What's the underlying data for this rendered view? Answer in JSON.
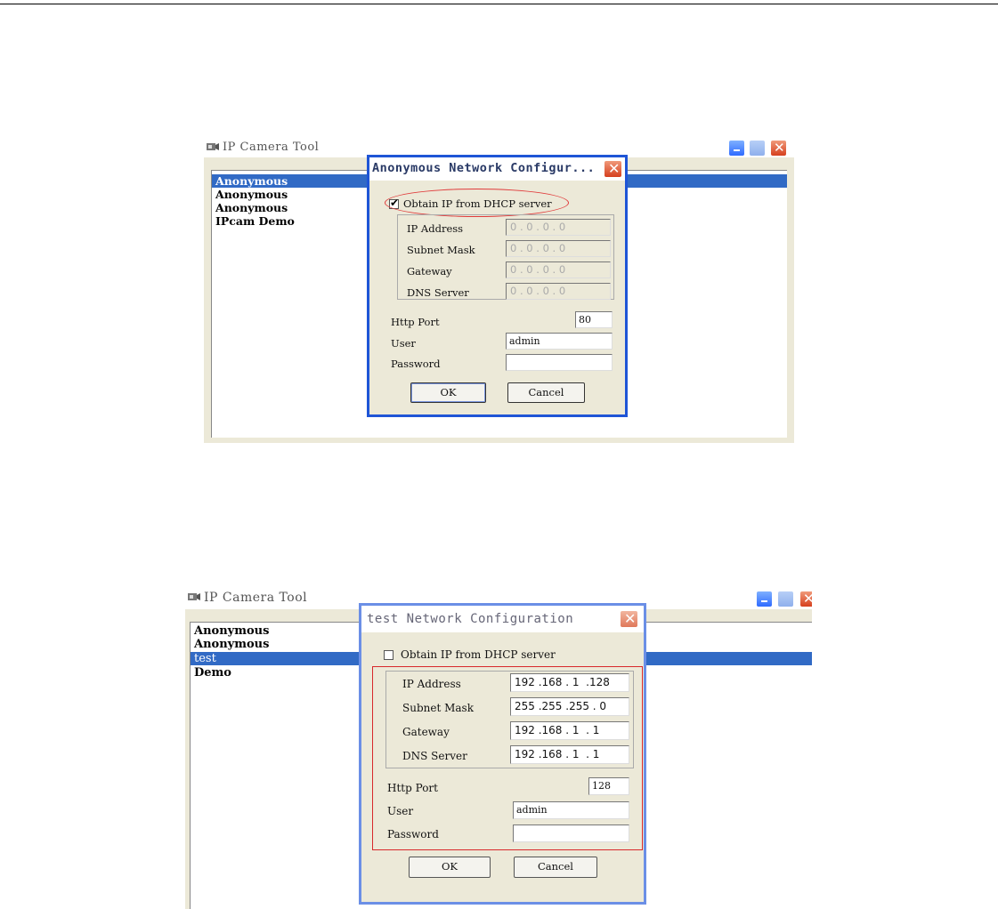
{
  "screens": [
    {
      "window_title": "IP Camera Tool",
      "list_items": [
        "Anonymous",
        "Anonymous",
        "Anonymous",
        "IPcam Demo"
      ],
      "selected_index": 0,
      "dialog": {
        "title": "Anonymous Network Configur...",
        "dhcp_label": "Obtain IP from DHCP server",
        "dhcp_checked": true,
        "fields": [
          {
            "label": "IP Address",
            "value": "0 . 0 . 0 . 0"
          },
          {
            "label": "Subnet Mask",
            "value": "0 . 0 . 0 . 0"
          },
          {
            "label": "Gateway",
            "value": "0 . 0 . 0 . 0"
          },
          {
            "label": "DNS Server",
            "value": "0 . 0 . 0 . 0"
          }
        ],
        "http_port_label": "Http Port",
        "http_port": "80",
        "user_label": "User",
        "user": "admin",
        "password_label": "Password",
        "password": "",
        "ok_label": "OK",
        "cancel_label": "Cancel"
      }
    },
    {
      "window_title": "IP Camera Tool",
      "list_items": [
        "Anonymous",
        "Anonymous",
        "test",
        "Demo"
      ],
      "selected_index": 2,
      "dialog": {
        "title": "test Network Configuration",
        "dhcp_label": "Obtain IP from DHCP server",
        "dhcp_checked": false,
        "fields": [
          {
            "label": "IP Address",
            "value": "192 .168 . 1  .128"
          },
          {
            "label": "Subnet Mask",
            "value": "255 .255 .255 . 0"
          },
          {
            "label": "Gateway",
            "value": "192 .168 . 1  . 1"
          },
          {
            "label": "DNS Server",
            "value": "192 .168 . 1  . 1"
          }
        ],
        "http_port_label": "Http Port",
        "http_port": "128",
        "user_label": "User",
        "user": "admin",
        "password_label": "Password",
        "password": "",
        "ok_label": "OK",
        "cancel_label": "Cancel"
      }
    }
  ],
  "colors": {
    "selection": "#316ac5",
    "dialog_border": "#1f55d6",
    "highlight_red": "#e03a3a"
  }
}
